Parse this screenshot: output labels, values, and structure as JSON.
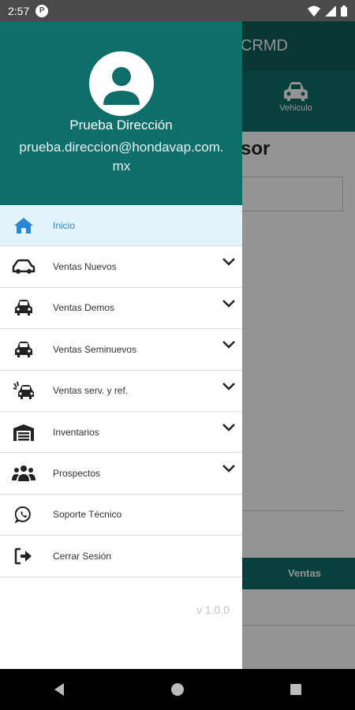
{
  "status_bar": {
    "time": "2:57",
    "notif_icon": "app-notification-icon"
  },
  "app": {
    "title": "CRMD",
    "tab_label": "Vehiculo",
    "heading": "sor",
    "ventas_label": "Ventas"
  },
  "drawer": {
    "user_name": "Prueba Dirección",
    "user_email": "prueba.direccion@hondavap.com.mx",
    "items": [
      {
        "label": "Inicio",
        "icon": "home-icon",
        "expandable": false,
        "active": true
      },
      {
        "label": "Ventas Nuevos",
        "icon": "car-outline-icon",
        "expandable": true
      },
      {
        "label": "Ventas Demos",
        "icon": "car-icon",
        "expandable": true
      },
      {
        "label": "Ventas Seminuevos",
        "icon": "car-icon",
        "expandable": true
      },
      {
        "label": "Ventas serv. y ref.",
        "icon": "car-crash-icon",
        "expandable": true
      },
      {
        "label": "Inventarios",
        "icon": "warehouse-icon",
        "expandable": true
      },
      {
        "label": "Prospectos",
        "icon": "users-icon",
        "expandable": true
      },
      {
        "label": "Soporte Técnico",
        "icon": "whatsapp-icon",
        "expandable": false
      },
      {
        "label": "Cerrar Sesión",
        "icon": "logout-icon",
        "expandable": false
      }
    ],
    "version": "v 1.0.0"
  },
  "colors": {
    "primary": "#0e6e69",
    "active_bg": "#e2f4fb",
    "active_text": "#2a86d6"
  }
}
